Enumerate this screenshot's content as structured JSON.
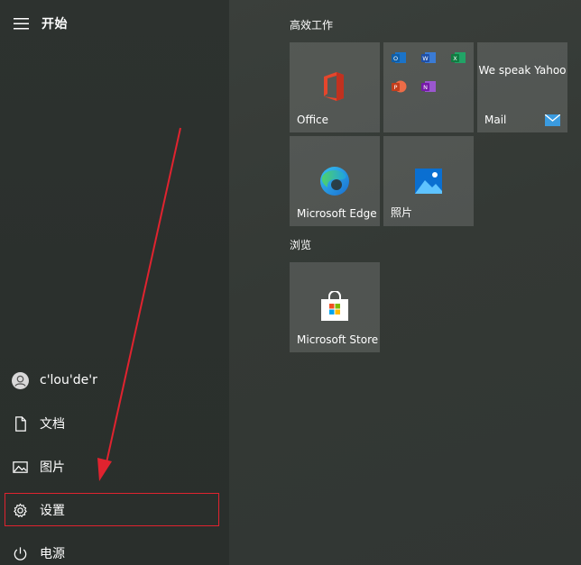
{
  "start": {
    "title": "开始"
  },
  "rail": {
    "user": "c'lou'de'r",
    "documents": "文档",
    "pictures": "图片",
    "settings": "设置",
    "power": "电源"
  },
  "groups": {
    "productivity": "高效工作",
    "browse": "浏览"
  },
  "tiles": {
    "office": "Office",
    "mail": "Mail",
    "mail_promo": "We speak Yahoo",
    "edge": "Microsoft Edge",
    "photos": "照片",
    "store": "Microsoft Store"
  },
  "colors": {
    "annotation_red": "#e0232f"
  }
}
